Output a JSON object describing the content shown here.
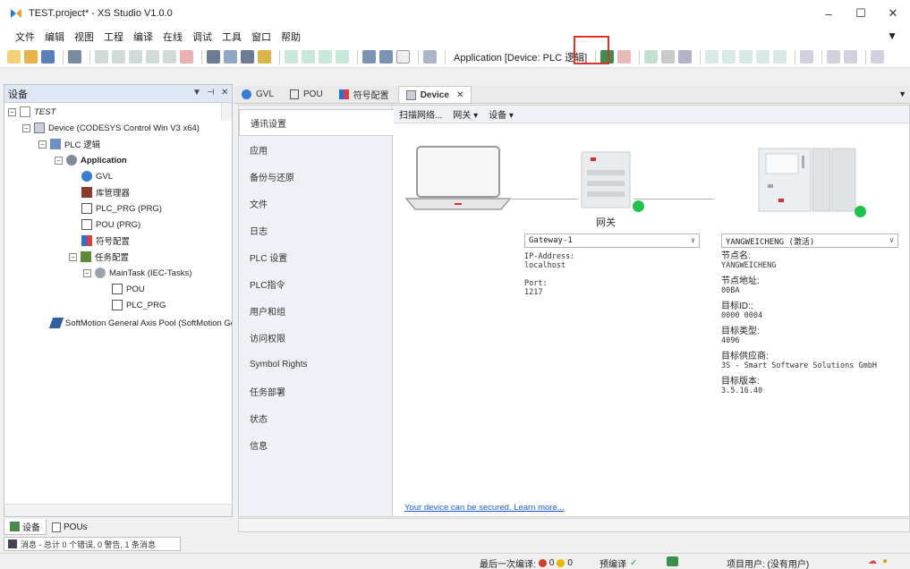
{
  "window": {
    "title": "TEST.project* - XS Studio V1.0.0",
    "minimize": "–",
    "maximize": "☐",
    "close": "✕"
  },
  "menu": [
    "文件",
    "编辑",
    "视图",
    "工程",
    "编译",
    "在线",
    "调试",
    "工具",
    "窗口",
    "帮助"
  ],
  "toolbar": {
    "target_label": "Application [Device: PLC 逻辑]"
  },
  "left_panel": {
    "title": "设备",
    "tree": {
      "root": "TEST",
      "device": "Device (CODESYS Control Win V3 x64)",
      "plc_logic": "PLC 逻辑",
      "application": "Application",
      "gvl": "GVL",
      "library_manager": "库管理器",
      "plc_prg": "PLC_PRG (PRG)",
      "pou": "POU (PRG)",
      "symbol_config": "符号配置",
      "task_config": "任务配置",
      "main_task": "MainTask (IEC-Tasks)",
      "task_pou": "POU",
      "task_plc_prg": "PLC_PRG",
      "softmotion": "SoftMotion General Axis Pool (SoftMotion Gen"
    },
    "bottom_tabs": [
      "设备",
      "POUs"
    ]
  },
  "message_bar": "消息 - 总计 0 个错误, 0 警告, 1 条消息",
  "doc_tabs": [
    "GVL",
    "POU",
    "符号配置",
    "Device"
  ],
  "device_nav": [
    "通讯设置",
    "应用",
    "备份与还原",
    "文件",
    "日志",
    "PLC 设置",
    "PLC指令",
    "用户和组",
    "访问权限",
    "Symbol Rights",
    "任务部署",
    "状态",
    "信息"
  ],
  "comm": {
    "toolbar": [
      "扫描网络...",
      "网关 ▾",
      "设备 ▾"
    ],
    "gateway_label": "网关",
    "gateway_select": "Gateway-1",
    "gateway_info": {
      "ip_label": "IP-Address:",
      "ip_value": "localhost",
      "port_label": "Port:",
      "port_value": "1217"
    },
    "device_select": "YANGWEICHENG (激活)",
    "device_info": [
      {
        "label": "节点名:",
        "value": "YANGWEICHENG"
      },
      {
        "label": "节点地址:",
        "value": "00BA"
      },
      {
        "label": "目标ID::",
        "value": "0000  0004"
      },
      {
        "label": "目标类型:",
        "value": "4096"
      },
      {
        "label": "目标供应商:",
        "value": "3S - Smart Software Solutions GmbH"
      },
      {
        "label": "目标版本:",
        "value": "3.5.16.40"
      }
    ],
    "secure_link": "Your device can be secured. Learn more..."
  },
  "status": {
    "last_build": "最后一次编译:",
    "errors": "0",
    "warnings": "0",
    "precompile": "预编译",
    "project_user": "项目用户: (没有用户)"
  },
  "colors": {
    "online_green": "#1fc24a",
    "highlight_red": "#e0302c",
    "link_blue": "#1a5cc8"
  }
}
